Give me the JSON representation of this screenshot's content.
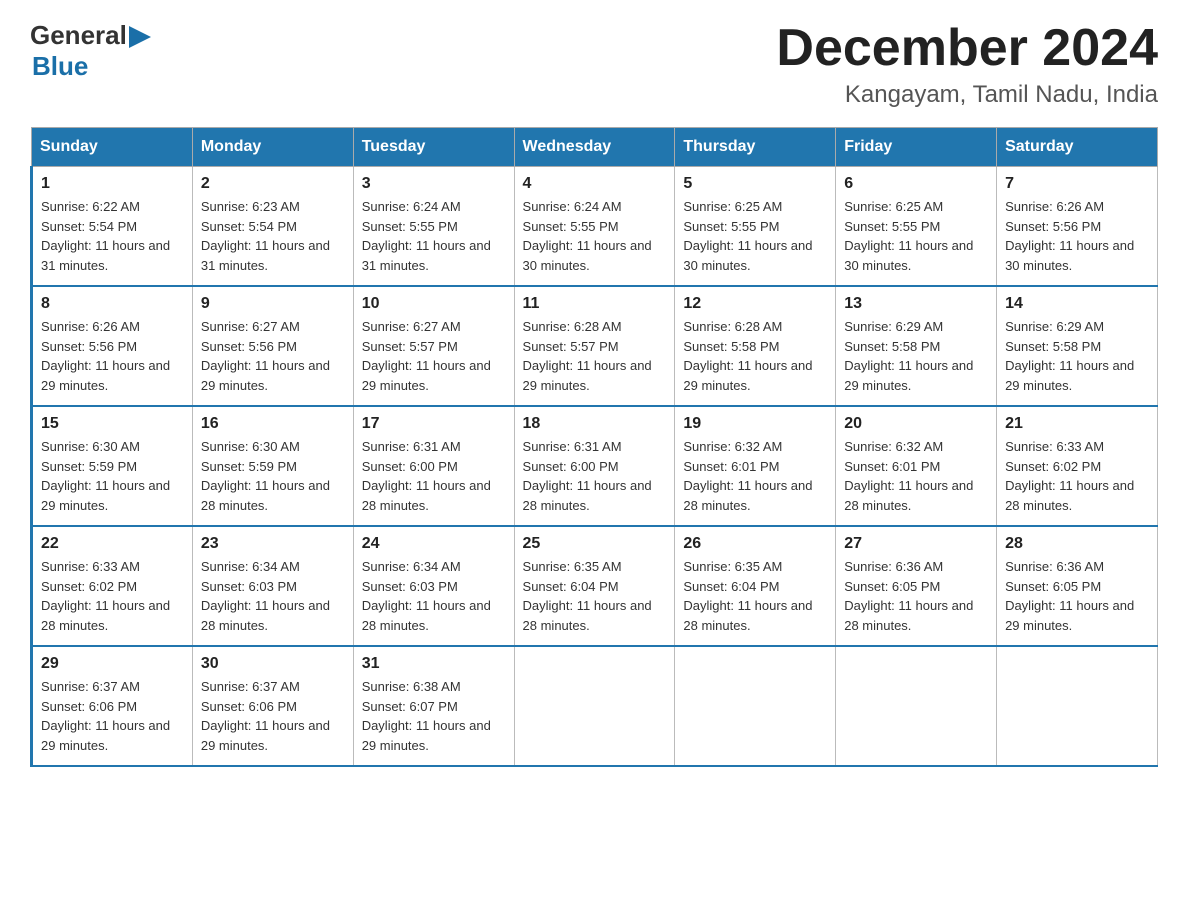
{
  "logo": {
    "general": "General",
    "blue": "Blue",
    "arrow": "▶"
  },
  "title": "December 2024",
  "location": "Kangayam, Tamil Nadu, India",
  "days_of_week": [
    "Sunday",
    "Monday",
    "Tuesday",
    "Wednesday",
    "Thursday",
    "Friday",
    "Saturday"
  ],
  "weeks": [
    [
      {
        "day": "1",
        "sunrise": "6:22 AM",
        "sunset": "5:54 PM",
        "daylight": "11 hours and 31 minutes."
      },
      {
        "day": "2",
        "sunrise": "6:23 AM",
        "sunset": "5:54 PM",
        "daylight": "11 hours and 31 minutes."
      },
      {
        "day": "3",
        "sunrise": "6:24 AM",
        "sunset": "5:55 PM",
        "daylight": "11 hours and 31 minutes."
      },
      {
        "day": "4",
        "sunrise": "6:24 AM",
        "sunset": "5:55 PM",
        "daylight": "11 hours and 30 minutes."
      },
      {
        "day": "5",
        "sunrise": "6:25 AM",
        "sunset": "5:55 PM",
        "daylight": "11 hours and 30 minutes."
      },
      {
        "day": "6",
        "sunrise": "6:25 AM",
        "sunset": "5:55 PM",
        "daylight": "11 hours and 30 minutes."
      },
      {
        "day": "7",
        "sunrise": "6:26 AM",
        "sunset": "5:56 PM",
        "daylight": "11 hours and 30 minutes."
      }
    ],
    [
      {
        "day": "8",
        "sunrise": "6:26 AM",
        "sunset": "5:56 PM",
        "daylight": "11 hours and 29 minutes."
      },
      {
        "day": "9",
        "sunrise": "6:27 AM",
        "sunset": "5:56 PM",
        "daylight": "11 hours and 29 minutes."
      },
      {
        "day": "10",
        "sunrise": "6:27 AM",
        "sunset": "5:57 PM",
        "daylight": "11 hours and 29 minutes."
      },
      {
        "day": "11",
        "sunrise": "6:28 AM",
        "sunset": "5:57 PM",
        "daylight": "11 hours and 29 minutes."
      },
      {
        "day": "12",
        "sunrise": "6:28 AM",
        "sunset": "5:58 PM",
        "daylight": "11 hours and 29 minutes."
      },
      {
        "day": "13",
        "sunrise": "6:29 AM",
        "sunset": "5:58 PM",
        "daylight": "11 hours and 29 minutes."
      },
      {
        "day": "14",
        "sunrise": "6:29 AM",
        "sunset": "5:58 PM",
        "daylight": "11 hours and 29 minutes."
      }
    ],
    [
      {
        "day": "15",
        "sunrise": "6:30 AM",
        "sunset": "5:59 PM",
        "daylight": "11 hours and 29 minutes."
      },
      {
        "day": "16",
        "sunrise": "6:30 AM",
        "sunset": "5:59 PM",
        "daylight": "11 hours and 28 minutes."
      },
      {
        "day": "17",
        "sunrise": "6:31 AM",
        "sunset": "6:00 PM",
        "daylight": "11 hours and 28 minutes."
      },
      {
        "day": "18",
        "sunrise": "6:31 AM",
        "sunset": "6:00 PM",
        "daylight": "11 hours and 28 minutes."
      },
      {
        "day": "19",
        "sunrise": "6:32 AM",
        "sunset": "6:01 PM",
        "daylight": "11 hours and 28 minutes."
      },
      {
        "day": "20",
        "sunrise": "6:32 AM",
        "sunset": "6:01 PM",
        "daylight": "11 hours and 28 minutes."
      },
      {
        "day": "21",
        "sunrise": "6:33 AM",
        "sunset": "6:02 PM",
        "daylight": "11 hours and 28 minutes."
      }
    ],
    [
      {
        "day": "22",
        "sunrise": "6:33 AM",
        "sunset": "6:02 PM",
        "daylight": "11 hours and 28 minutes."
      },
      {
        "day": "23",
        "sunrise": "6:34 AM",
        "sunset": "6:03 PM",
        "daylight": "11 hours and 28 minutes."
      },
      {
        "day": "24",
        "sunrise": "6:34 AM",
        "sunset": "6:03 PM",
        "daylight": "11 hours and 28 minutes."
      },
      {
        "day": "25",
        "sunrise": "6:35 AM",
        "sunset": "6:04 PM",
        "daylight": "11 hours and 28 minutes."
      },
      {
        "day": "26",
        "sunrise": "6:35 AM",
        "sunset": "6:04 PM",
        "daylight": "11 hours and 28 minutes."
      },
      {
        "day": "27",
        "sunrise": "6:36 AM",
        "sunset": "6:05 PM",
        "daylight": "11 hours and 28 minutes."
      },
      {
        "day": "28",
        "sunrise": "6:36 AM",
        "sunset": "6:05 PM",
        "daylight": "11 hours and 29 minutes."
      }
    ],
    [
      {
        "day": "29",
        "sunrise": "6:37 AM",
        "sunset": "6:06 PM",
        "daylight": "11 hours and 29 minutes."
      },
      {
        "day": "30",
        "sunrise": "6:37 AM",
        "sunset": "6:06 PM",
        "daylight": "11 hours and 29 minutes."
      },
      {
        "day": "31",
        "sunrise": "6:38 AM",
        "sunset": "6:07 PM",
        "daylight": "11 hours and 29 minutes."
      },
      null,
      null,
      null,
      null
    ]
  ]
}
